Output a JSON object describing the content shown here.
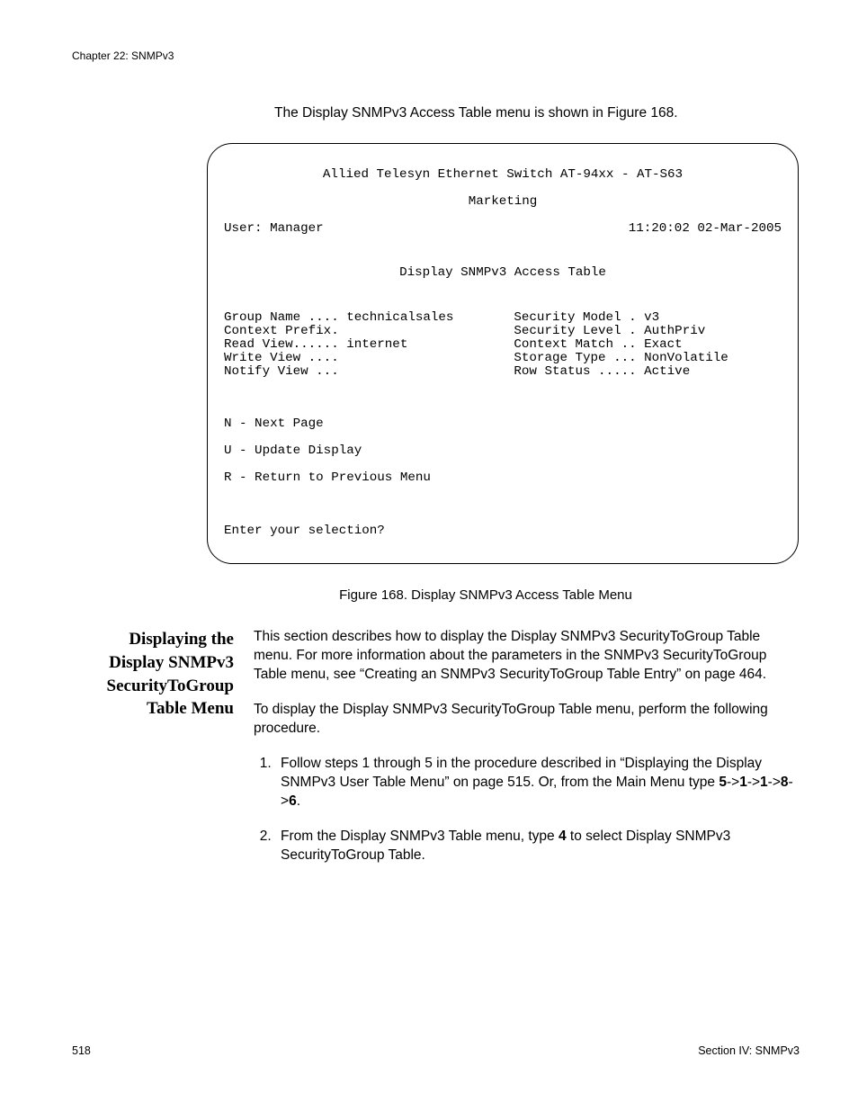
{
  "header": {
    "chapter": "Chapter 22: SNMPv3"
  },
  "intro": "The Display SNMPv3 Access Table menu is shown in Figure 168.",
  "terminal": {
    "title": "Allied Telesyn Ethernet Switch AT-94xx - AT-S63",
    "subtitle": "Marketing",
    "user_label": "User: Manager",
    "timestamp": "11:20:02 02-Mar-2005",
    "menu_title": "Display SNMPv3 Access Table",
    "left_rows": {
      "group_name": "Group Name .... technicalsales",
      "context_prefix": "Context Prefix.",
      "read_view": "Read View...... internet",
      "write_view": "Write View ....",
      "notify_view": "Notify View ..."
    },
    "right_rows": {
      "security_model": "Security Model . v3",
      "security_level": "Security Level . AuthPriv",
      "context_match": "Context Match .. Exact",
      "storage_type": "Storage Type ... NonVolatile",
      "row_status": "Row Status ..... Active"
    },
    "options": {
      "n": "N - Next Page",
      "u": "U - Update Display",
      "r": "R - Return to Previous Menu"
    },
    "prompt": "Enter your selection?"
  },
  "figure_caption": "Figure 168. Display SNMPv3 Access Table Menu",
  "section": {
    "heading": "Displaying the Display SNMPv3 SecurityToGroup Table Menu",
    "para1": "This section describes how to display the Display SNMPv3 SecurityToGroup Table menu. For more information about the parameters in the SNMPv3 SecurityToGroup Table menu, see “Creating an SNMPv3 SecurityToGroup Table Entry” on page 464.",
    "para2": "To display the Display SNMPv3 SecurityToGroup Table menu, perform the following procedure.",
    "step1_pre": "Follow steps 1 through 5 in the procedure described in “Displaying the Display SNMPv3 User Table Menu” on page 515. Or, from the Main Menu type ",
    "step1_seq": {
      "a": "5",
      "s1": "->",
      "b": "1",
      "s2": "->",
      "c": "1",
      "s3": "->",
      "d": "8",
      "s4": "->",
      "e": "6",
      "end": "."
    },
    "step2_pre": "From the Display SNMPv3 Table menu, type ",
    "step2_bold": "4",
    "step2_post": " to select Display SNMPv3 SecurityToGroup Table."
  },
  "footer": {
    "page": "518",
    "section": "Section IV: SNMPv3"
  }
}
